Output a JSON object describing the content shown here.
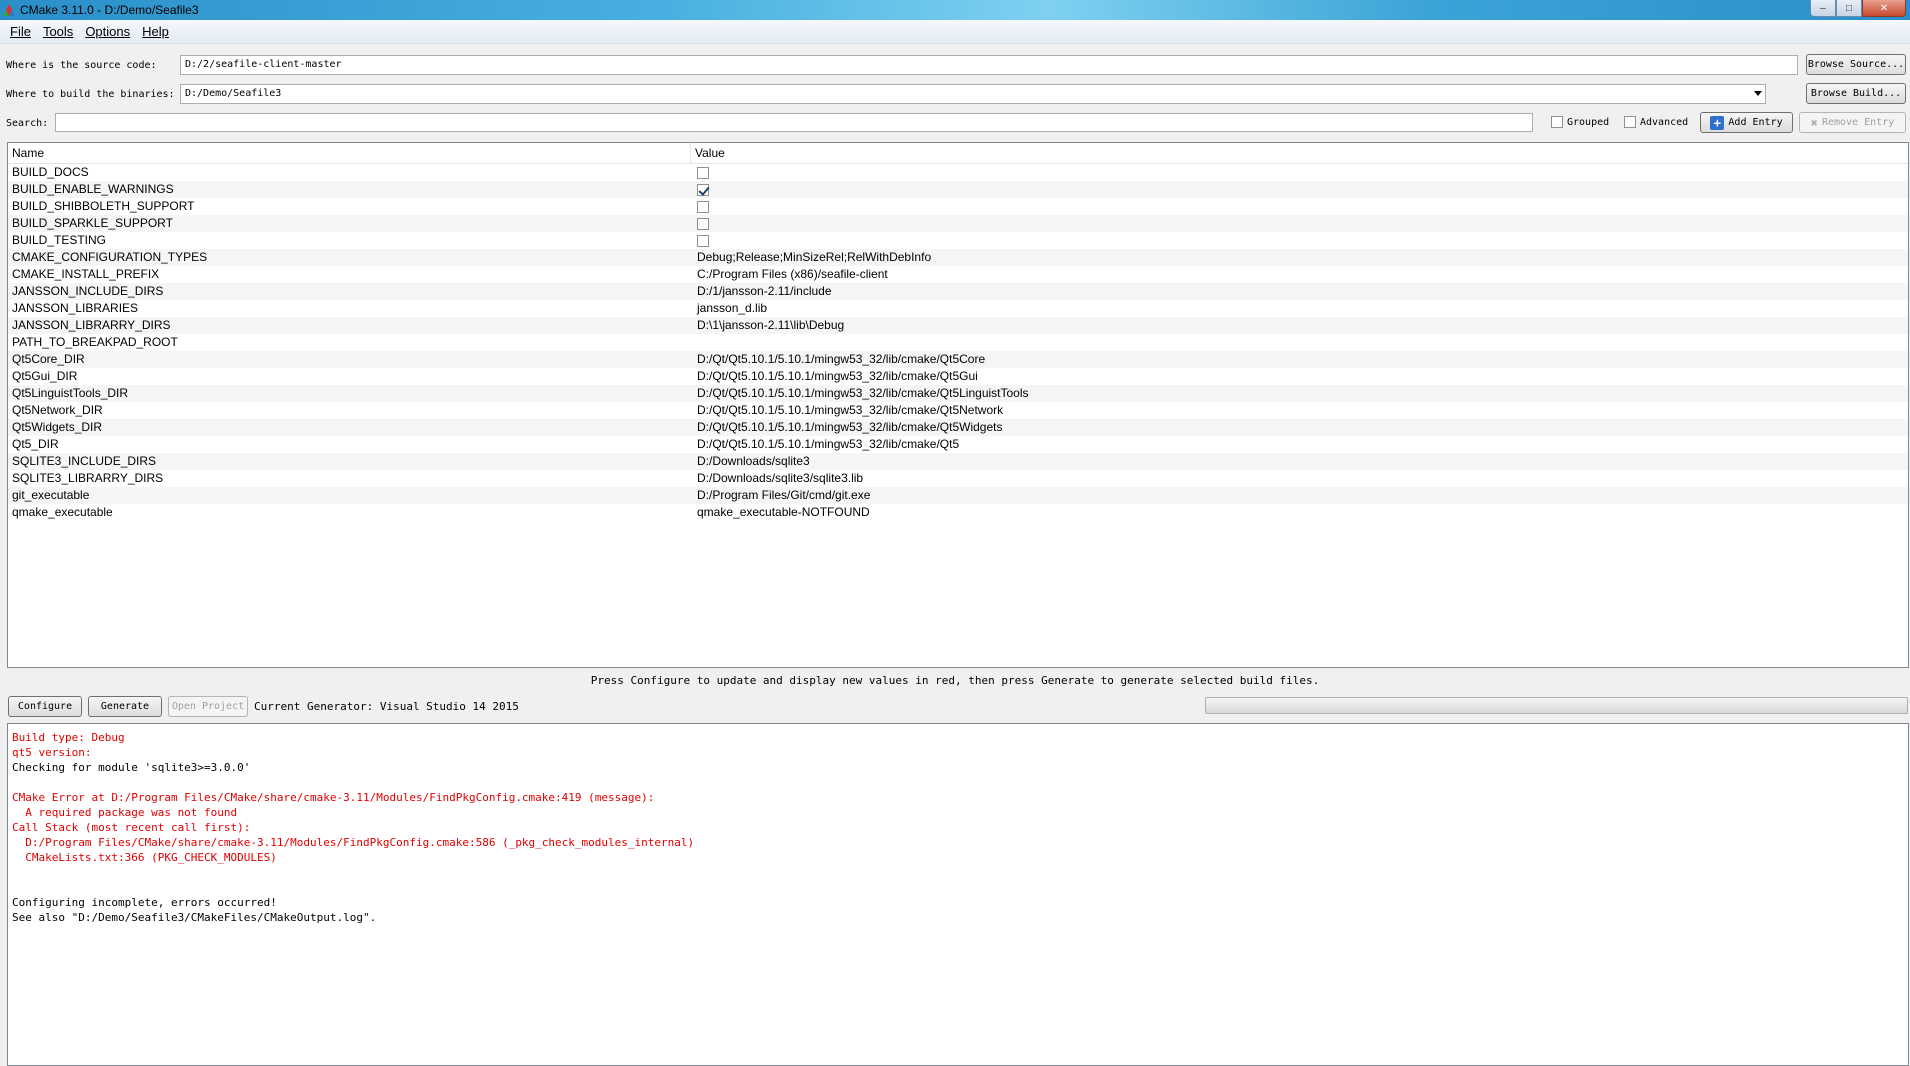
{
  "window": {
    "title": "CMake 3.11.0 - D:/Demo/Seafile3",
    "controls": {
      "minimize": "–",
      "maximize": "□",
      "close": "✕"
    }
  },
  "menu": [
    {
      "label": "File"
    },
    {
      "label": "Tools"
    },
    {
      "label": "Options"
    },
    {
      "label": "Help"
    }
  ],
  "source": {
    "label": "Where is the source code:",
    "value": "D:/2/seafile-client-master",
    "browse_label": "Browse Source..."
  },
  "build": {
    "label": "Where to build the binaries:",
    "value": "D:/Demo/Seafile3",
    "browse_label": "Browse Build..."
  },
  "search": {
    "label": "Search:",
    "value": "",
    "grouped_label": "Grouped",
    "grouped_checked": false,
    "advanced_label": "Advanced",
    "advanced_checked": false,
    "add_entry_label": "Add Entry",
    "remove_entry_label": "Remove Entry"
  },
  "table": {
    "columns": [
      "Name",
      "Value"
    ],
    "rows": [
      {
        "name": "BUILD_DOCS",
        "type": "bool",
        "checked": false
      },
      {
        "name": "BUILD_ENABLE_WARNINGS",
        "type": "bool",
        "checked": true
      },
      {
        "name": "BUILD_SHIBBOLETH_SUPPORT",
        "type": "bool",
        "checked": false
      },
      {
        "name": "BUILD_SPARKLE_SUPPORT",
        "type": "bool",
        "checked": false
      },
      {
        "name": "BUILD_TESTING",
        "type": "bool",
        "checked": false
      },
      {
        "name": "CMAKE_CONFIGURATION_TYPES",
        "type": "text",
        "value": "Debug;Release;MinSizeRel;RelWithDebInfo"
      },
      {
        "name": "CMAKE_INSTALL_PREFIX",
        "type": "text",
        "value": "C:/Program Files (x86)/seafile-client"
      },
      {
        "name": "JANSSON_INCLUDE_DIRS",
        "type": "text",
        "value": "D:/1/jansson-2.11/include"
      },
      {
        "name": "JANSSON_LIBRARIES",
        "type": "text",
        "value": "jansson_d.lib"
      },
      {
        "name": "JANSSON_LIBRARRY_DIRS",
        "type": "text",
        "value": "D:\\1\\jansson-2.11\\lib\\Debug"
      },
      {
        "name": "PATH_TO_BREAKPAD_ROOT",
        "type": "text",
        "value": ""
      },
      {
        "name": "Qt5Core_DIR",
        "type": "text",
        "value": "D:/Qt/Qt5.10.1/5.10.1/mingw53_32/lib/cmake/Qt5Core"
      },
      {
        "name": "Qt5Gui_DIR",
        "type": "text",
        "value": "D:/Qt/Qt5.10.1/5.10.1/mingw53_32/lib/cmake/Qt5Gui"
      },
      {
        "name": "Qt5LinguistTools_DIR",
        "type": "text",
        "value": "D:/Qt/Qt5.10.1/5.10.1/mingw53_32/lib/cmake/Qt5LinguistTools"
      },
      {
        "name": "Qt5Network_DIR",
        "type": "text",
        "value": "D:/Qt/Qt5.10.1/5.10.1/mingw53_32/lib/cmake/Qt5Network"
      },
      {
        "name": "Qt5Widgets_DIR",
        "type": "text",
        "value": "D:/Qt/Qt5.10.1/5.10.1/mingw53_32/lib/cmake/Qt5Widgets"
      },
      {
        "name": "Qt5_DIR",
        "type": "text",
        "value": "D:/Qt/Qt5.10.1/5.10.1/mingw53_32/lib/cmake/Qt5"
      },
      {
        "name": "SQLITE3_INCLUDE_DIRS",
        "type": "text",
        "value": "D:/Downloads/sqlite3"
      },
      {
        "name": "SQLITE3_LIBRARRY_DIRS",
        "type": "text",
        "value": "D:/Downloads/sqlite3/sqlite3.lib"
      },
      {
        "name": "git_executable",
        "type": "text",
        "value": "D:/Program Files/Git/cmd/git.exe"
      },
      {
        "name": "qmake_executable",
        "type": "text",
        "value": "qmake_executable-NOTFOUND"
      }
    ]
  },
  "hint": "Press Configure to update and display new values in red, then press Generate to generate selected build files.",
  "actions": {
    "configure_label": "Configure",
    "generate_label": "Generate",
    "open_project_label": "Open Project",
    "generator_text": "Current Generator: Visual Studio 14 2015"
  },
  "progress": {
    "fraction": 0
  },
  "output": [
    {
      "text": "Build type: Debug",
      "level": "error"
    },
    {
      "text": "qt5 version:",
      "level": "error"
    },
    {
      "text": "Checking for module 'sqlite3>=3.0.0'",
      "level": "info"
    },
    {
      "text": "",
      "level": "info"
    },
    {
      "text": "CMake Error at D:/Program Files/CMake/share/cmake-3.11/Modules/FindPkgConfig.cmake:419 (message):",
      "level": "error"
    },
    {
      "text": "  A required package was not found",
      "level": "error"
    },
    {
      "text": "Call Stack (most recent call first):",
      "level": "error"
    },
    {
      "text": "  D:/Program Files/CMake/share/cmake-3.11/Modules/FindPkgConfig.cmake:586 (_pkg_check_modules_internal)",
      "level": "error"
    },
    {
      "text": "  CMakeLists.txt:366 (PKG_CHECK_MODULES)",
      "level": "error"
    },
    {
      "text": "",
      "level": "info"
    },
    {
      "text": "",
      "level": "info"
    },
    {
      "text": "Configuring incomplete, errors occurred!",
      "level": "info"
    },
    {
      "text": "See also \"D:/Demo/Seafile3/CMakeFiles/CMakeOutput.log\".",
      "level": "info"
    }
  ],
  "colors": {
    "error": "#e00000",
    "info": "#000000",
    "titlebar": "#2a8fc9"
  }
}
